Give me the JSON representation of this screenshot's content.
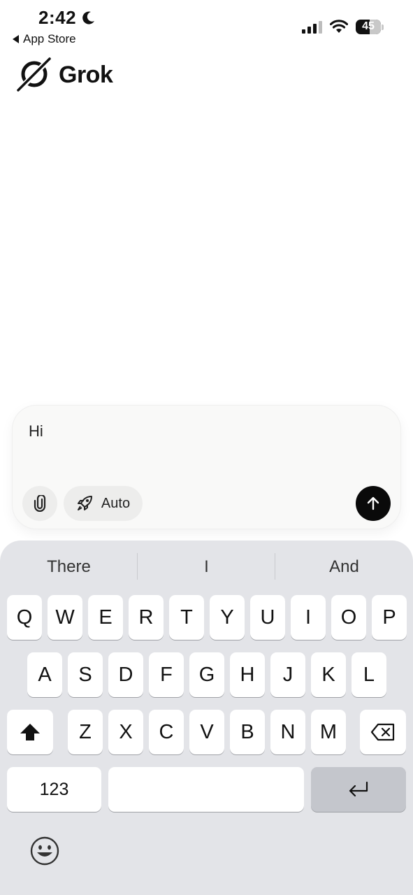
{
  "status_bar": {
    "time": "2:42",
    "back_label": "App Store",
    "battery": "45"
  },
  "app": {
    "name": "Grok"
  },
  "composer": {
    "input_text": "Hi",
    "mode_label": "Auto"
  },
  "keyboard": {
    "suggestions": [
      "There",
      "I",
      "And"
    ],
    "row1": [
      "Q",
      "W",
      "E",
      "R",
      "T",
      "Y",
      "U",
      "I",
      "O",
      "P"
    ],
    "row2": [
      "A",
      "S",
      "D",
      "F",
      "G",
      "H",
      "J",
      "K",
      "L"
    ],
    "row3": [
      "Z",
      "X",
      "C",
      "V",
      "B",
      "N",
      "M"
    ],
    "numbers_label": "123"
  }
}
